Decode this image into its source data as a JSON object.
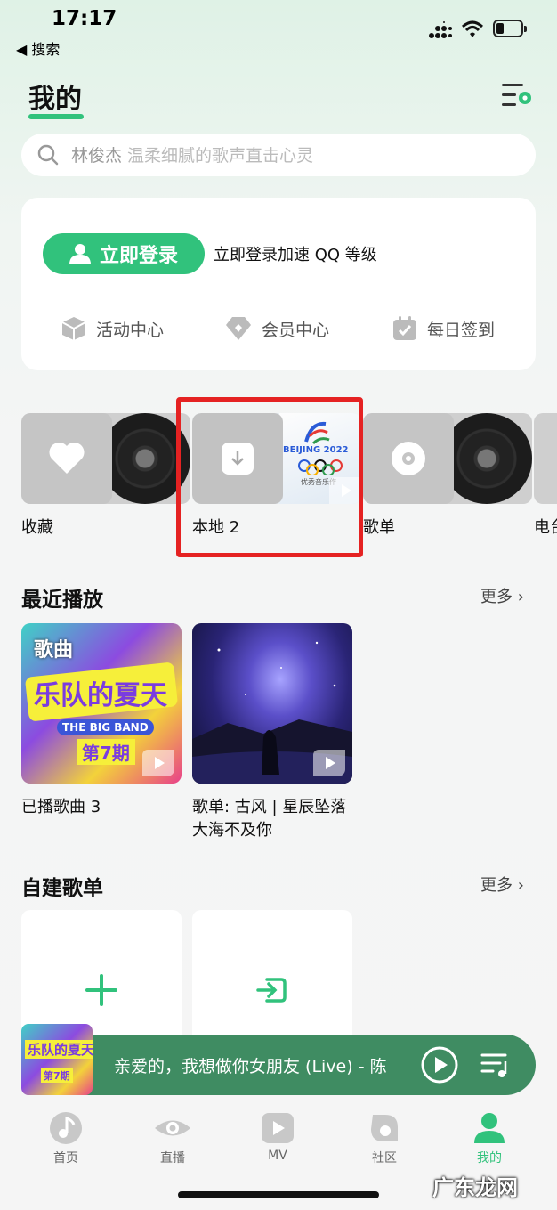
{
  "status_bar": {
    "time": "17:17",
    "back_label": "◀ 搜索"
  },
  "header": {
    "title": "我的"
  },
  "search": {
    "keyword": "林俊杰",
    "hint": "温柔细腻的歌声直击心灵"
  },
  "login": {
    "button_label": "立即登录",
    "description": "立即登录加速 QQ 等级",
    "quick_links": [
      {
        "label": "活动中心",
        "icon": "cube-icon"
      },
      {
        "label": "会员中心",
        "icon": "diamond-icon"
      },
      {
        "label": "每日签到",
        "icon": "calendar-check-icon"
      }
    ]
  },
  "shelf": {
    "items": [
      {
        "label": "收藏",
        "icon": "heart-icon"
      },
      {
        "label": "本地 2",
        "icon": "download-icon",
        "highlighted": true
      },
      {
        "label": "歌单",
        "icon": "disc-icon"
      },
      {
        "label": "电台",
        "icon": "radio-icon"
      }
    ],
    "local_cover_text": "BEIJING 2022",
    "local_cover_sub": "优秀音乐作"
  },
  "recent": {
    "title": "最近播放",
    "more_label": "更多",
    "items": [
      {
        "caption": "已播歌曲 3",
        "cover_title": "乐队的夏天",
        "cover_tag": "歌曲",
        "cover_sub": "THE BIG BAND",
        "cover_issue": "第7期"
      },
      {
        "caption": "歌单: 古风 | 星辰坠落大海不及你"
      }
    ]
  },
  "playlists": {
    "title": "自建歌单",
    "more_label": "更多"
  },
  "player": {
    "now_playing": "亲爱的，我想做你女朋友 (Live) - 陈",
    "art_title": "乐队的夏天",
    "art_issue": "第7期"
  },
  "nav": {
    "items": [
      {
        "label": "首页",
        "icon": "music-note-icon"
      },
      {
        "label": "直播",
        "icon": "eye-icon"
      },
      {
        "label": "MV",
        "icon": "play-icon"
      },
      {
        "label": "社区",
        "icon": "community-icon"
      },
      {
        "label": "我的",
        "icon": "person-icon",
        "active": true
      }
    ]
  },
  "watermark": "广东龙网",
  "colors": {
    "accent": "#31c27c",
    "player_bg": "#3f8c62",
    "highlight_box": "#e52222"
  }
}
